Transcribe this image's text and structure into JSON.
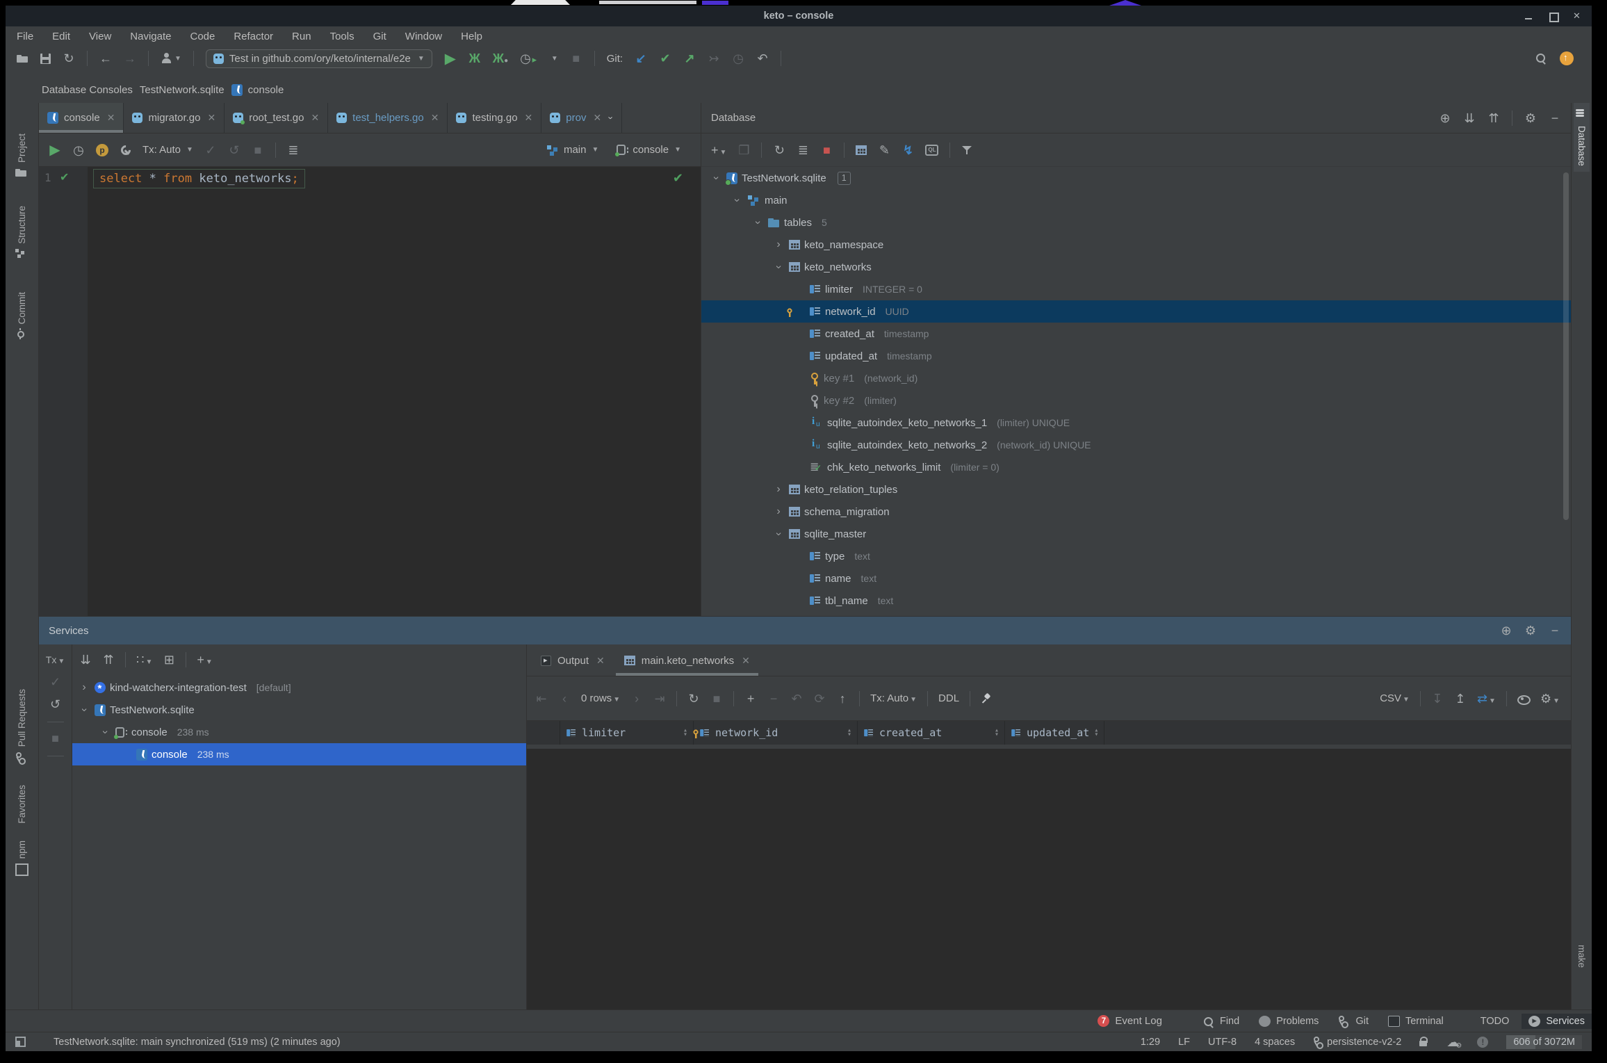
{
  "window": {
    "title": "keto – console"
  },
  "colors": {
    "selection_blue": "#2f65ca",
    "db_selection": "#0c3a5e",
    "keyword_orange": "#cc7832",
    "modified_tab_blue": "#6a9cc4",
    "services_header": "#3d5366",
    "update_badge_orange": "#e8a33d",
    "event_badge_red": "#d64f4f"
  },
  "menu": [
    {
      "label": "File"
    },
    {
      "label": "Edit"
    },
    {
      "label": "View"
    },
    {
      "label": "Navigate"
    },
    {
      "label": "Code"
    },
    {
      "label": "Refactor"
    },
    {
      "label": "Run"
    },
    {
      "label": "Tools"
    },
    {
      "label": "Git"
    },
    {
      "label": "Window"
    },
    {
      "label": "Help"
    }
  ],
  "toolbar": {
    "run_config": "Test in github.com/ory/keto/internal/e2e",
    "git_label": "Git:"
  },
  "breadcrumbs": [
    {
      "label": "Database Consoles"
    },
    {
      "label": "TestNetwork.sqlite"
    },
    {
      "label": "console",
      "icon": "sql-console"
    }
  ],
  "left_strip": [
    {
      "label": "Project",
      "icon": "folder-gray"
    },
    {
      "label": "Structure",
      "icon": "structure"
    },
    {
      "label": "Commit",
      "icon": "commit"
    },
    {
      "label": "Pull Requests",
      "icon": "branch"
    },
    {
      "label": "Favorites",
      "icon": "star"
    },
    {
      "label": "npm",
      "icon": "npm"
    }
  ],
  "right_strip": [
    {
      "label": "Database",
      "icon": "dbstack",
      "active": true
    },
    {
      "label": "make",
      "icon": "make"
    }
  ],
  "editor_tabs": [
    {
      "label": "console",
      "icon": "sql-console",
      "active": true
    },
    {
      "label": "migrator.go",
      "icon": "gopher"
    },
    {
      "label": "root_test.go",
      "icon": "gopher-test"
    },
    {
      "label": "test_helpers.go",
      "icon": "gopher",
      "modified": true
    },
    {
      "label": "testing.go",
      "icon": "gopher"
    },
    {
      "label": "prov",
      "icon": "gopher",
      "modified": true,
      "more": true
    }
  ],
  "console_toolbar": {
    "tx": "Tx: Auto",
    "schema": "main",
    "session": "console"
  },
  "editor": {
    "line_number": "1",
    "tokens": [
      {
        "text": "select",
        "cls": "kw"
      },
      {
        "text": " ",
        "cls": "pl"
      },
      {
        "text": "*",
        "cls": "pl"
      },
      {
        "text": " ",
        "cls": "pl"
      },
      {
        "text": "from",
        "cls": "kw"
      },
      {
        "text": " ",
        "cls": "pl"
      },
      {
        "text": "keto_networks",
        "cls": "pl"
      },
      {
        "text": ";",
        "cls": "kw"
      }
    ]
  },
  "database_panel": {
    "title": "Database",
    "tree": [
      {
        "level": 0,
        "chevron": "down",
        "icon": "sqlite",
        "label": "TestNetwork.sqlite",
        "badge": "1"
      },
      {
        "level": 1,
        "chevron": "down",
        "icon": "schema",
        "label": "main"
      },
      {
        "level": 2,
        "chevron": "down",
        "icon": "folder",
        "label": "tables",
        "meta": "5"
      },
      {
        "level": 3,
        "chevron": "right",
        "icon": "table",
        "label": "keto_namespace"
      },
      {
        "level": 3,
        "chevron": "down",
        "icon": "table",
        "label": "keto_networks"
      },
      {
        "level": 4,
        "icon": "column",
        "label": "limiter",
        "meta": "INTEGER = 0"
      },
      {
        "level": 4,
        "icon": "column-key",
        "label": "network_id",
        "meta": "UUID",
        "selected": true
      },
      {
        "level": 4,
        "icon": "column",
        "label": "created_at",
        "meta": "timestamp"
      },
      {
        "level": 4,
        "icon": "column",
        "label": "updated_at",
        "meta": "timestamp"
      },
      {
        "level": 4,
        "icon": "key-gold",
        "label": "key #1",
        "meta": "(network_id)",
        "dim": true
      },
      {
        "level": 4,
        "icon": "key-gray",
        "label": "key #2",
        "meta": "(limiter)",
        "dim": true
      },
      {
        "level": 4,
        "icon": "index",
        "label": "sqlite_autoindex_keto_networks_1",
        "meta": "(limiter) UNIQUE"
      },
      {
        "level": 4,
        "icon": "index",
        "label": "sqlite_autoindex_keto_networks_2",
        "meta": "(network_id) UNIQUE"
      },
      {
        "level": 4,
        "icon": "check",
        "label": "chk_keto_networks_limit",
        "meta": "(limiter = 0)"
      },
      {
        "level": 3,
        "chevron": "right",
        "icon": "table",
        "label": "keto_relation_tuples"
      },
      {
        "level": 3,
        "chevron": "right",
        "icon": "table",
        "label": "schema_migration"
      },
      {
        "level": 3,
        "chevron": "down",
        "icon": "table",
        "label": "sqlite_master"
      },
      {
        "level": 4,
        "icon": "column",
        "label": "type",
        "meta": "text"
      },
      {
        "level": 4,
        "icon": "column",
        "label": "name",
        "meta": "text"
      },
      {
        "level": 4,
        "icon": "column",
        "label": "tbl_name",
        "meta": "text"
      },
      {
        "level": 4,
        "icon": "column",
        "label": "",
        "meta": ""
      }
    ]
  },
  "services_panel": {
    "title": "Services",
    "tx_label": "Tx",
    "tree": [
      {
        "indent": 0,
        "chevron": "right",
        "icon": "kubernetes",
        "label": "kind-watcherx-integration-test",
        "meta": "[default]"
      },
      {
        "indent": 0,
        "chevron": "down",
        "icon": "sqlite-file",
        "label": "TestNetwork.sqlite"
      },
      {
        "indent": 1,
        "chevron": "down",
        "icon": "session",
        "label": "console",
        "meta": "238 ms"
      },
      {
        "indent": 2,
        "icon": "sqlite-file",
        "label": "console",
        "meta": "238 ms",
        "selected": true
      }
    ]
  },
  "output": {
    "tabs": [
      {
        "label": "Output",
        "icon": "output"
      },
      {
        "label": "main.keto_networks",
        "icon": "table",
        "active": true
      }
    ],
    "toolbar": {
      "rows_label": "0 rows",
      "tx": "Tx: Auto",
      "ddl": "DDL",
      "csv": "CSV"
    },
    "grid_columns": [
      {
        "label": "limiter",
        "icon": "column"
      },
      {
        "label": "network_id",
        "icon": "column-key"
      },
      {
        "label": "created_at",
        "icon": "column"
      },
      {
        "label": "updated_at",
        "icon": "column"
      }
    ]
  },
  "bottom_bar": {
    "items": [
      {
        "label": "Find",
        "icon": "mag"
      },
      {
        "label": "Problems",
        "icon": "excl"
      },
      {
        "label": "Git",
        "icon": "branch"
      },
      {
        "label": "Terminal",
        "icon": "term"
      },
      {
        "label": "TODO",
        "icon": "todo"
      },
      {
        "label": "Services",
        "icon": "services",
        "active": true
      }
    ],
    "event_log": {
      "label": "Event Log",
      "badge": "7"
    }
  },
  "status_bar": {
    "message": "TestNetwork.sqlite: main synchronized (519 ms) (2 minutes ago)",
    "caret": "1:29",
    "line_ending": "LF",
    "encoding": "UTF-8",
    "indent": "4 spaces",
    "branch": "persistence-v2-2",
    "memory": "606 of 3072M"
  }
}
